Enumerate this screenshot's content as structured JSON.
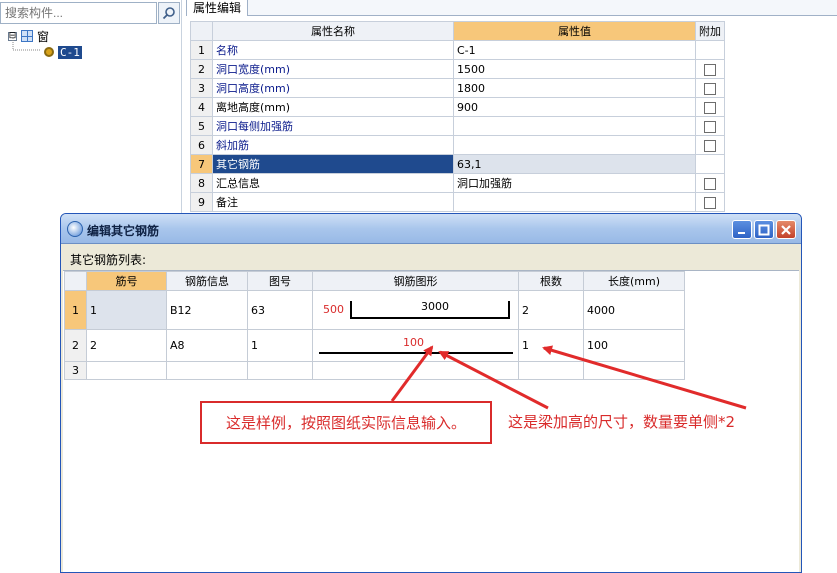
{
  "left_panel": {
    "search_placeholder": "搜索构件...",
    "tree": {
      "root_label": "窗",
      "root_expander": "⊟",
      "child_label": "C-1"
    }
  },
  "property_panel": {
    "tab_label": "属性编辑",
    "headers": {
      "num": "",
      "name": "属性名称",
      "value": "属性值",
      "add": "附加"
    },
    "rows": [
      {
        "num": "1",
        "name": "名称",
        "value": "C-1",
        "has_checkbox": false
      },
      {
        "num": "2",
        "name": "洞口宽度(mm)",
        "value": "1500",
        "has_checkbox": true
      },
      {
        "num": "3",
        "name": "洞口高度(mm)",
        "value": "1800",
        "has_checkbox": true
      },
      {
        "num": "4",
        "name": "离地高度(mm)",
        "value": "900",
        "has_checkbox": true
      },
      {
        "num": "5",
        "name": "洞口每侧加强筋",
        "value": "",
        "has_checkbox": true
      },
      {
        "num": "6",
        "name": "斜加筋",
        "value": "",
        "has_checkbox": true
      },
      {
        "num": "7",
        "name": "其它钢筋",
        "value": "63,1",
        "has_checkbox": false
      },
      {
        "num": "8",
        "name": "汇总信息",
        "value": "洞口加强筋",
        "has_checkbox": true
      },
      {
        "num": "9",
        "name": "备注",
        "value": "",
        "has_checkbox": true
      }
    ]
  },
  "dialog": {
    "title": "编辑其它钢筋",
    "list_label": "其它钢筋列表:",
    "headers": {
      "num": "",
      "code": "筋号",
      "info": "钢筋信息",
      "fig": "图号",
      "shape": "钢筋图形",
      "count": "根数",
      "length": "长度(mm)"
    },
    "rows": [
      {
        "num": "1",
        "code": "1",
        "info": "B12",
        "fig": "63",
        "shape_left": "500",
        "shape_mid": "3000",
        "count": "2",
        "length": "4000"
      },
      {
        "num": "2",
        "code": "2",
        "info": "A8",
        "fig": "1",
        "shape_mid": "100",
        "count": "1",
        "length": "100"
      },
      {
        "num": "3",
        "code": "",
        "info": "",
        "fig": "",
        "count": "",
        "length": ""
      }
    ]
  },
  "annotations": {
    "note1": "这是样例，按照图纸实际信息输入。",
    "note2": "这是梁加高的尺寸，数量要单侧*2"
  },
  "colors": {
    "selection": "#1f4a8e",
    "header_highlight": "#f7c77a",
    "annotation_red": "#d92b2b"
  }
}
